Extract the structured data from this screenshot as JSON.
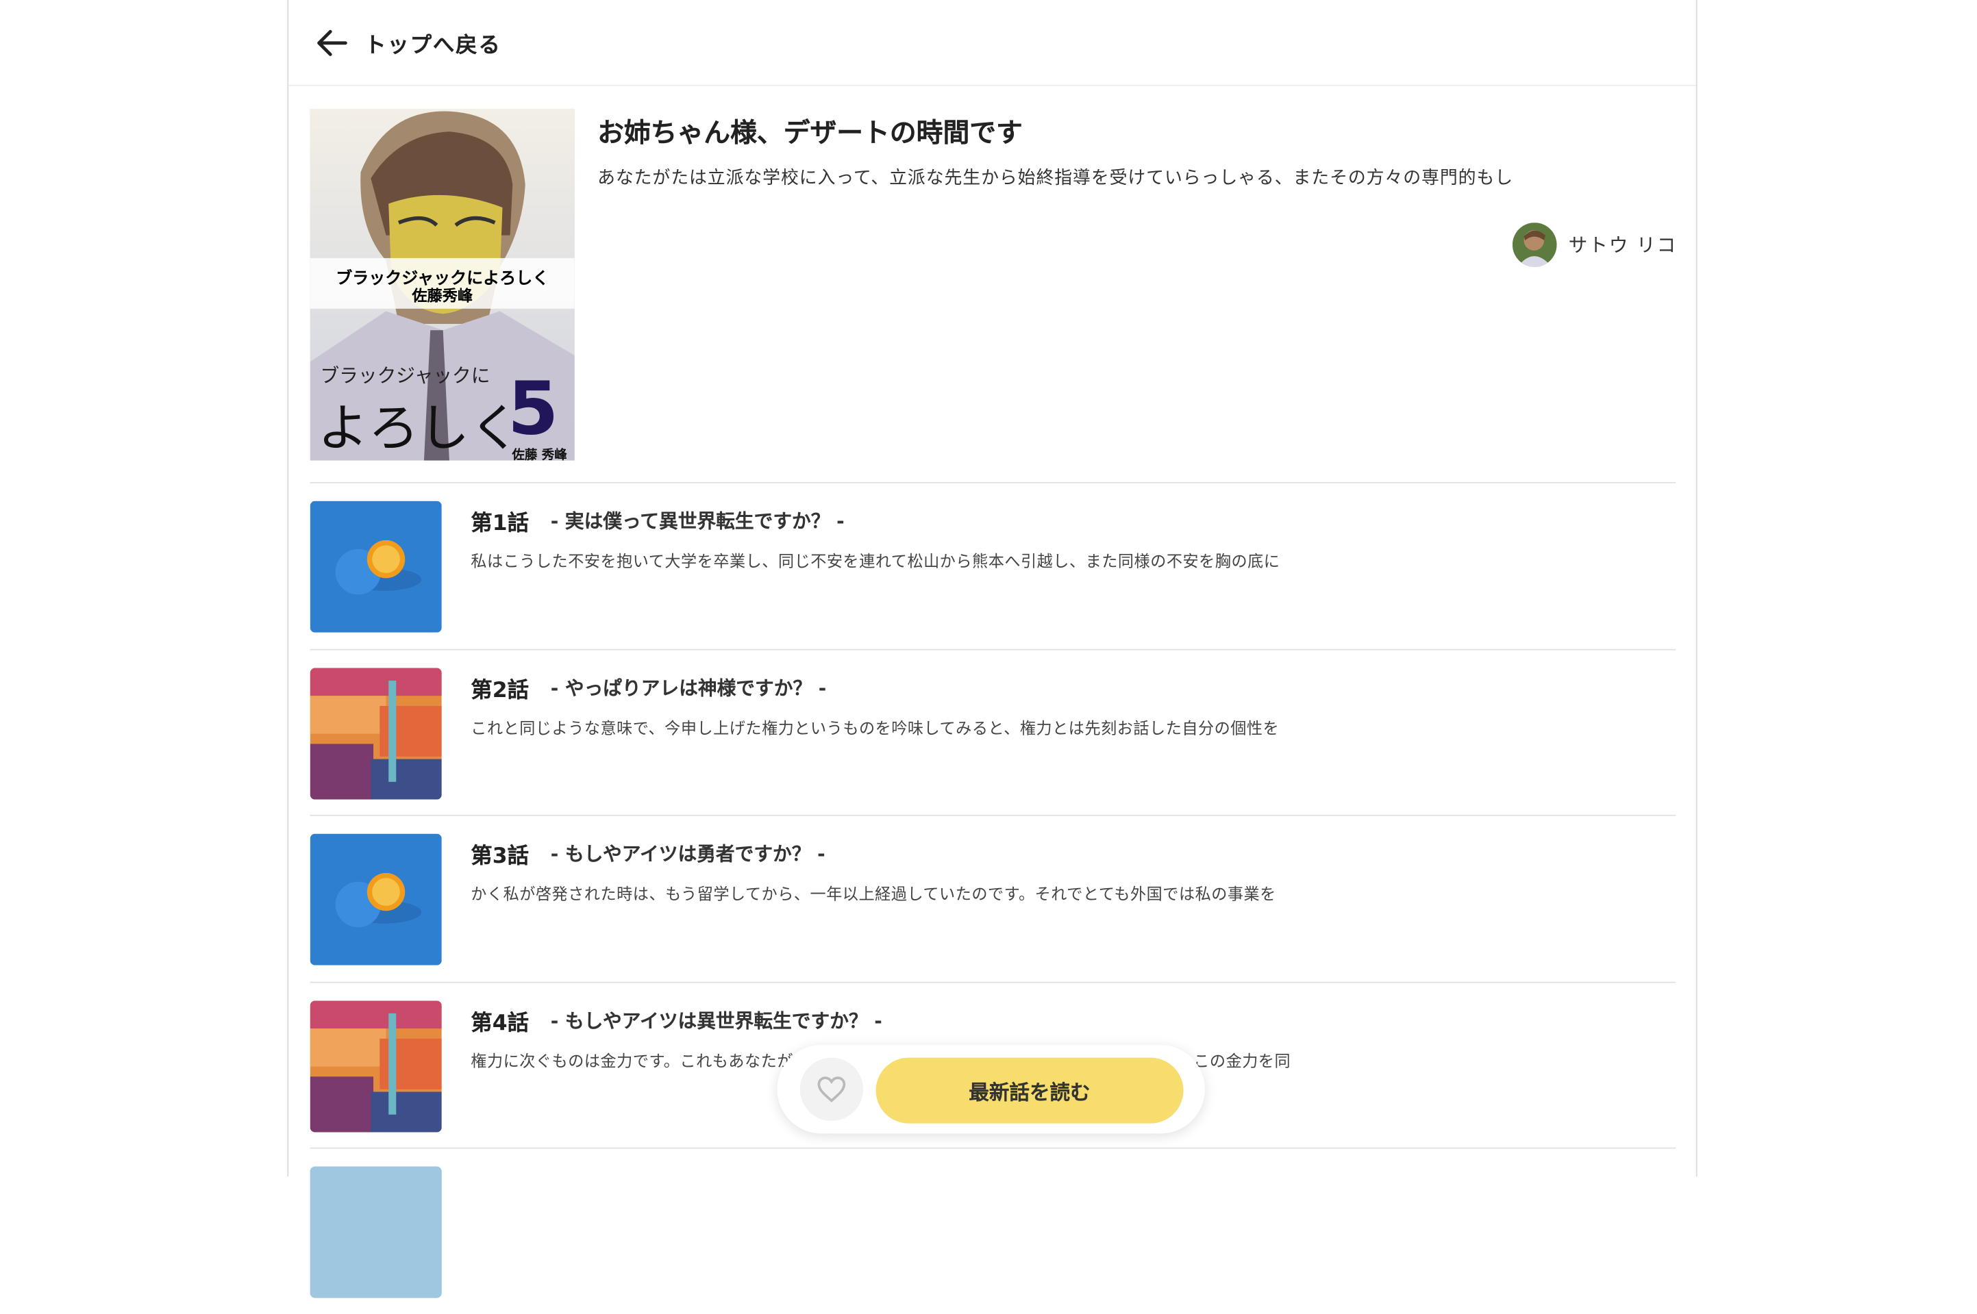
{
  "header": {
    "back_label": "トップへ戻る"
  },
  "series": {
    "title": "お姉ちゃん様、デザートの時間です",
    "description": "あなたがたは立派な学校に入って、立派な先生から始終指導を受けていらっしゃる、またその方々の専門的もし",
    "author": "サトウ リコ",
    "cover": {
      "line1": "ブラックジャックによろしく",
      "line2": "佐藤秀峰",
      "line3": "ブラックジャックに",
      "line4": "よろしく",
      "volume": "5",
      "author_small": "佐藤 秀峰"
    }
  },
  "episodes": [
    {
      "number": "第1話",
      "subtitle": "- 実は僕って異世界転生ですか？ -",
      "description": "私はこうした不安を抱いて大学を卒業し、同じ不安を連れて松山から熊本へ引越し、また同様の不安を胸の底に",
      "thumb": "orange-icon"
    },
    {
      "number": "第2話",
      "subtitle": "- やっぱりアレは神様ですか？ -",
      "description": "これと同じような意味で、今申し上げた権力というものを吟味してみると、権力とは先刻お話した自分の個性を",
      "thumb": "painting-icon"
    },
    {
      "number": "第3話",
      "subtitle": "- もしやアイツは勇者ですか？ -",
      "description": "かく私が啓発された時は、もう留学してから、一年以上経過していたのです。それでとても外国では私の事業を",
      "thumb": "orange-icon"
    },
    {
      "number": "第4話",
      "subtitle": "- もしやアイツは異世界転生ですか？ -",
      "description": "権力に次ぐものは金力です。これもあなたが",
      "description_tail": "この金力を同",
      "thumb": "painting-icon"
    }
  ],
  "float_bar": {
    "read_label": "最新話を読む",
    "fav_icon": "heart-icon"
  },
  "colors": {
    "accent_yellow": "#f7dd6e",
    "thumb_blue": "#2f7fd1"
  }
}
